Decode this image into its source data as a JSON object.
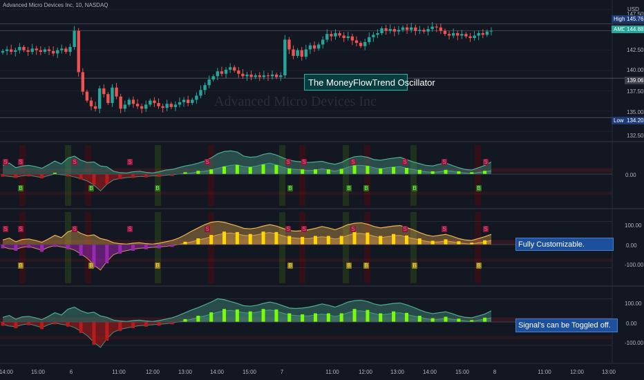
{
  "header": {
    "title": "Advanced Micro Devices Inc, 10, NASDAQ",
    "currency": "USD"
  },
  "watermark": "Advanced Micro Devices Inc",
  "annotations": {
    "main": "The MoneyFlowTrend Oscillator",
    "pane2": "Fully Customizable.",
    "pane3": "Signal's can be Toggled off."
  },
  "price_scale": {
    "ticks": [
      "147.50",
      "142.50",
      "140.00",
      "137.50",
      "135.00",
      "132.50"
    ],
    "labels": {
      "high_tag": "High",
      "high_value": "145.76",
      "sym_tag": "AMD",
      "sym_value": "144.88",
      "mid_value": "139.06",
      "low_tag": "Low",
      "low_value": "134.20"
    }
  },
  "osc_scale": {
    "pane1": [
      "0.00"
    ],
    "pane2": [
      "100.00",
      "0.00",
      "-100.00"
    ],
    "pane3": [
      "100.00",
      "0.00",
      "-100.00"
    ]
  },
  "time_axis": [
    "14:00",
    "15:00",
    "6",
    "11:00",
    "12:00",
    "13:00",
    "14:00",
    "15:00",
    "7",
    "11:00",
    "12:00",
    "13:00",
    "14:00",
    "15:00",
    "8",
    "11:00",
    "12:00",
    "13:00"
  ],
  "signal_labels": {
    "sell": "S",
    "buy": "B"
  },
  "colors": {
    "background": "#131722",
    "up": "#26a69a",
    "down": "#ef5350",
    "callout_bg": "#083d3f",
    "callout_border": "#1fb9a6",
    "note_bg": "#1c4f9c",
    "high_tag": "#1e3a78",
    "sym_tag": "#26a69a",
    "osc_green": "#4caf93",
    "osc_red": "#b71c1c",
    "osc_gold": "#f0b452",
    "osc_purple": "#9c27b0"
  },
  "chart_data": [
    {
      "type": "candlestick",
      "title": "Advanced Micro Devices Inc, 10, NASDAQ",
      "ylim": [
        131.5,
        148
      ],
      "y_ticks": [
        132.5,
        135,
        137.5,
        140,
        142.5,
        147.5
      ],
      "price_lines": {
        "high": 145.76,
        "last": 144.88,
        "mid": 139.06,
        "low": 134.2
      },
      "closes": [
        142.4,
        142.6,
        142.3,
        142.5,
        142.9,
        142.5,
        142.3,
        142.7,
        142.5,
        142.3,
        142.6,
        142.4,
        142.1,
        142.5,
        142.7,
        142.3,
        142.9,
        144.9,
        139.8,
        137.4,
        136.3,
        135.6,
        135.3,
        137.8,
        137.1,
        136.0,
        137.9,
        136.8,
        135.3,
        135.8,
        136.4,
        135.9,
        135.6,
        135.3,
        135.8,
        136.3,
        136.0,
        135.6,
        135.4,
        135.9,
        135.5,
        135.8,
        136.1,
        136.4,
        136.0,
        136.4,
        136.9,
        137.6,
        138.2,
        138.9,
        139.3,
        139.9,
        139.6,
        140.1,
        140.4,
        140.0,
        139.6,
        139.3,
        139.5,
        139.2,
        139.4,
        139.2,
        139.4,
        139.3,
        139.5,
        139.2,
        139.4,
        143.8,
        142.6,
        141.8,
        142.5,
        141.7,
        142.6,
        143.1,
        142.7,
        143.2,
        143.8,
        144.5,
        144.2,
        144.6,
        144.3,
        144.0,
        144.2,
        143.7,
        143.4,
        143.0,
        143.5,
        144.1,
        144.4,
        144.6,
        145.2,
        144.9,
        145.1,
        144.8,
        145.0,
        145.3,
        145.0,
        145.3,
        144.9,
        145.0,
        144.8,
        145.1,
        145.4,
        145.3,
        144.9,
        144.5,
        144.3,
        144.6,
        144.3,
        144.5,
        144.2,
        144.0,
        144.3,
        144.6,
        144.4,
        144.8,
        144.9
      ]
    },
    {
      "type": "area",
      "name": "MoneyFlowTrend pane 1",
      "ylim": [
        -100,
        100
      ],
      "y_ticks": [
        0
      ],
      "upper": [
        30,
        38,
        22,
        28,
        30,
        26,
        20,
        32,
        45,
        35,
        55,
        62,
        48,
        40,
        42,
        28,
        25,
        10,
        5,
        4,
        8,
        10,
        6,
        4,
        8,
        14,
        16,
        22,
        28,
        32,
        38,
        45,
        56,
        70,
        78,
        80,
        76,
        62,
        58,
        60,
        68,
        72,
        66,
        56,
        48,
        44,
        42,
        40,
        42,
        44,
        38,
        34,
        40,
        52,
        60,
        62,
        58,
        50,
        48,
        52,
        55,
        58,
        50,
        42,
        36,
        30,
        28,
        34,
        38,
        30,
        22,
        16,
        14,
        22,
        30,
        42
      ],
      "lower": [
        -5,
        -8,
        -10,
        -6,
        -4,
        -8,
        -12,
        -5,
        0,
        -2,
        -4,
        -10,
        -16,
        -24,
        -38,
        -58,
        -35,
        -20,
        -15,
        -12,
        -10,
        -8,
        -8,
        -6,
        -6,
        -4,
        -2,
        0,
        2,
        4,
        8,
        10,
        14,
        20,
        26,
        30,
        32,
        26,
        24,
        28,
        34,
        38,
        32,
        24,
        18,
        16,
        14,
        12,
        14,
        18,
        14,
        10,
        16,
        24,
        30,
        30,
        28,
        22,
        18,
        22,
        24,
        26,
        20,
        16,
        12,
        8,
        6,
        8,
        12,
        10,
        6,
        4,
        2,
        6,
        8,
        12
      ],
      "signals": {
        "sell": 11,
        "buy": 8
      }
    },
    {
      "type": "area",
      "name": "MoneyFlowTrend pane 2",
      "ylim": [
        -140,
        140
      ],
      "y_ticks": [
        100,
        0,
        -100
      ],
      "upper": [
        20,
        28,
        12,
        22,
        24,
        18,
        10,
        24,
        40,
        30,
        55,
        64,
        48,
        38,
        42,
        26,
        20,
        8,
        4,
        2,
        6,
        8,
        4,
        2,
        6,
        12,
        18,
        28,
        42,
        58,
        72,
        86,
        96,
        100,
        96,
        88,
        80,
        70,
        68,
        72,
        80,
        86,
        80,
        70,
        60,
        58,
        60,
        64,
        70,
        78,
        72,
        64,
        74,
        86,
        92,
        94,
        88,
        78,
        72,
        76,
        80,
        82,
        74,
        64,
        52,
        42,
        36,
        40,
        44,
        36,
        26,
        20,
        18,
        26,
        34,
        44
      ],
      "lower": [
        -10,
        -18,
        -20,
        -12,
        -8,
        -16,
        -24,
        -12,
        -4,
        -10,
        -14,
        -24,
        -40,
        -60,
        -88,
        -110,
        -72,
        -44,
        -32,
        -26,
        -20,
        -16,
        -14,
        -12,
        -10,
        -8,
        -4,
        0,
        6,
        12,
        20,
        26,
        34,
        42,
        48,
        50,
        46,
        40,
        38,
        42,
        48,
        52,
        46,
        38,
        30,
        28,
        26,
        26,
        30,
        34,
        30,
        24,
        30,
        40,
        48,
        48,
        44,
        36,
        30,
        34,
        38,
        40,
        32,
        26,
        20,
        14,
        10,
        12,
        16,
        12,
        8,
        4,
        2,
        8,
        12,
        18
      ],
      "signals": {
        "sell": 11,
        "buy": 8
      }
    },
    {
      "type": "area",
      "name": "MoneyFlowTrend pane 3",
      "ylim": [
        -140,
        140
      ],
      "y_ticks": [
        100,
        0,
        -100
      ],
      "upper": [
        20,
        28,
        12,
        22,
        24,
        18,
        10,
        24,
        40,
        30,
        55,
        64,
        48,
        38,
        42,
        26,
        20,
        8,
        4,
        2,
        6,
        8,
        4,
        2,
        6,
        12,
        18,
        28,
        40,
        52,
        62,
        74,
        86,
        100,
        96,
        88,
        80,
        70,
        68,
        72,
        80,
        86,
        80,
        70,
        60,
        58,
        60,
        64,
        70,
        78,
        72,
        64,
        74,
        86,
        92,
        94,
        88,
        78,
        72,
        76,
        80,
        82,
        74,
        64,
        52,
        42,
        36,
        40,
        44,
        36,
        26,
        20,
        18,
        26,
        34,
        48
      ],
      "lower": [
        -10,
        -18,
        -20,
        -12,
        -8,
        -16,
        -24,
        -12,
        -4,
        -10,
        -14,
        -24,
        -40,
        -60,
        -88,
        -110,
        -72,
        -44,
        -32,
        -26,
        -20,
        -16,
        -14,
        -12,
        -10,
        -8,
        -4,
        0,
        6,
        12,
        20,
        26,
        34,
        42,
        48,
        50,
        46,
        40,
        38,
        42,
        48,
        52,
        46,
        38,
        30,
        28,
        26,
        26,
        30,
        34,
        30,
        24,
        30,
        40,
        48,
        48,
        44,
        36,
        30,
        34,
        38,
        40,
        32,
        26,
        20,
        14,
        10,
        12,
        16,
        12,
        8,
        4,
        2,
        8,
        12,
        18
      ],
      "signals": {
        "sell": 0,
        "buy": 0
      }
    }
  ]
}
